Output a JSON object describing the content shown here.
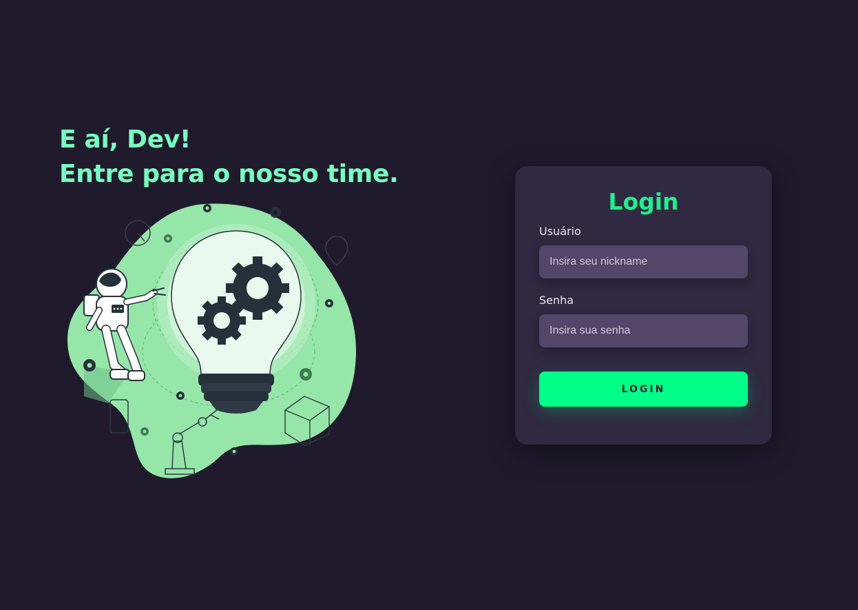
{
  "hero": {
    "line1": "E aí, Dev!",
    "line2": "Entre para o nosso time."
  },
  "login": {
    "title": "Login",
    "username_label": "Usuário",
    "username_placeholder": "Insira seu nickname",
    "username_value": "",
    "password_label": "Senha",
    "password_placeholder": "Insira sua senha",
    "password_value": "",
    "button_label": "LOGIN"
  },
  "illustration": {
    "subject": "astronaut-lightbulb-gears"
  },
  "colors": {
    "background": "#1f1b2d",
    "accent": "#00ff88",
    "heading": "#77ffc0",
    "card": "#2f2941",
    "input": "#514869",
    "blob": "#95e6a8"
  }
}
